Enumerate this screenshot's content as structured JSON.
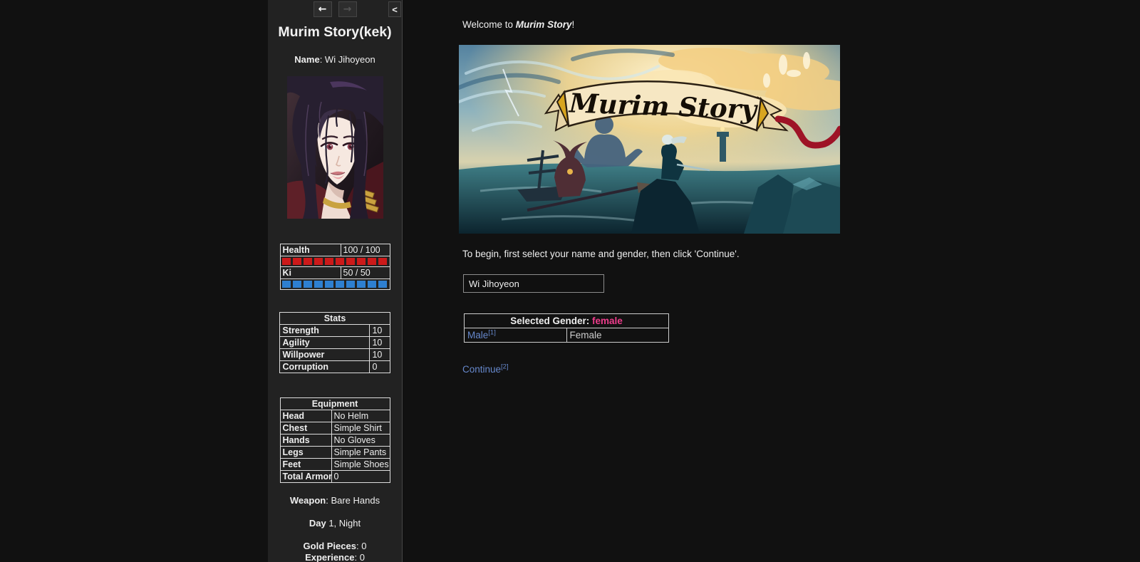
{
  "colors": {
    "page-bg": "#111111",
    "sidebar-bg": "#222222",
    "sidebar-border": "#444444",
    "table-border": "#dddddd",
    "text": "#eeeeee",
    "link-blue": "#6688cc",
    "gender-pink": "#ee3d8c",
    "health-red": "#cc1a1a",
    "ki-blue": "#2e7fd0"
  },
  "ui_bar": {
    "history": {
      "back_label": "←",
      "forward_label": "→",
      "toggle_label": "<"
    },
    "title": "Murim Story(kek)",
    "name": {
      "label": "Name",
      "sep": ": ",
      "value": "Wi Jihoyeon"
    },
    "portrait_icon": "character-portrait",
    "vitals": {
      "health": {
        "label": "Health",
        "value": "100 / 100",
        "segments": 10
      },
      "ki": {
        "label": "Ki",
        "value": "50 / 50",
        "segments": 10
      }
    },
    "stats": {
      "header": "Stats",
      "rows": [
        {
          "label": "Strength",
          "value": "10"
        },
        {
          "label": "Agility",
          "value": "10"
        },
        {
          "label": "Willpower",
          "value": "10"
        },
        {
          "label": "Corruption",
          "value": "0"
        }
      ]
    },
    "equipment": {
      "header": "Equipment",
      "rows": [
        {
          "label": "Head",
          "value": "No Helm"
        },
        {
          "label": "Chest",
          "value": "Simple Shirt"
        },
        {
          "label": "Hands",
          "value": "No Gloves"
        },
        {
          "label": "Legs",
          "value": "Simple Pants"
        },
        {
          "label": "Feet",
          "value": "Simple Shoes"
        },
        {
          "label": "Total Armor",
          "value": "0"
        }
      ]
    },
    "weapon": {
      "label": "Weapon",
      "sep": ": ",
      "value": "Bare Hands"
    },
    "day": {
      "label": "Day",
      "sep": " ",
      "value": "1, Night"
    },
    "gold": {
      "label": "Gold Pieces",
      "sep": ": ",
      "value": "0"
    },
    "experience": {
      "label": "Experience",
      "sep": ": ",
      "value": "0"
    }
  },
  "main": {
    "welcome": {
      "prefix": "Welcome to ",
      "title": "Murim Story",
      "suffix": "!"
    },
    "banner_title": "Murim Story",
    "instructions": "To begin, first select your name and gender, then click 'Continue'.",
    "name_input": {
      "value": "Wi Jihoyeon"
    },
    "gender_table": {
      "header_label": "Selected Gender:",
      "selected_value": "female",
      "male_link": {
        "label": "Male",
        "sup": "[1]"
      },
      "female_label": "Female"
    },
    "continue_link": {
      "label": "Continue",
      "sup": "[2]"
    }
  }
}
